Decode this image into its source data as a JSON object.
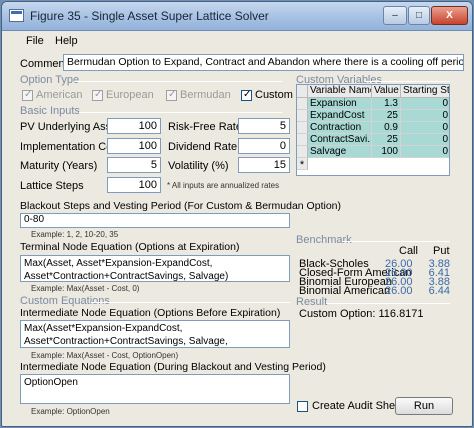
{
  "window": {
    "title": "Figure 35 - Single Asset Super Lattice Solver"
  },
  "titlebar_buttons": {
    "minimize": "–",
    "maximize": "□",
    "close": "X"
  },
  "menu": [
    "File",
    "Help"
  ],
  "comment": {
    "label": "Comment",
    "value": "Bermudan Option to Expand, Contract and Abandon where there is a cooling off period (blackout step periods)."
  },
  "option_type": {
    "label": "Option Type",
    "options": [
      {
        "label": "American",
        "checked": false
      },
      {
        "label": "European",
        "checked": false
      },
      {
        "label": "Bermudan",
        "checked": false
      },
      {
        "label": "Custom",
        "checked": true
      }
    ]
  },
  "basic_inputs": {
    "label": "Basic Inputs",
    "pv_asset": {
      "label": "PV Underlying Asset ($)",
      "value": "100"
    },
    "impl_cost": {
      "label": "Implementation Cost ($)",
      "value": "100"
    },
    "maturity": {
      "label": "Maturity (Years)",
      "value": "5"
    },
    "lattice_steps": {
      "label": "Lattice Steps",
      "value": "100"
    },
    "risk_free": {
      "label": "Risk-Free Rate (%)",
      "value": "5"
    },
    "dividend": {
      "label": "Dividend Rate (%)",
      "value": "0"
    },
    "volatility": {
      "label": "Volatility (%)",
      "value": "15"
    },
    "note": "* All inputs are annualized rates"
  },
  "blackout": {
    "label": "Blackout Steps and Vesting Period (For Custom & Bermudan Option)",
    "value": "0-80",
    "example": "Example: 1, 2, 10-20, 35"
  },
  "terminal": {
    "label": "Terminal Node Equation (Options at Expiration)",
    "value": "Max(Asset, Asset*Expansion-ExpandCost, Asset*Contraction+ContractSavings, Salvage)",
    "example": "Example: Max(Asset - Cost, 0)"
  },
  "custom_equations": {
    "label": "Custom Equations"
  },
  "intermediate": {
    "label": "Intermediate Node Equation (Options Before Expiration)",
    "value": "Max(Asset*Expansion-ExpandCost, Asset*Contraction+ContractSavings, Salvage, OptionOpen)",
    "example": "Example: Max(Asset - Cost, OptionOpen)"
  },
  "blackout_eq": {
    "label": "Intermediate Node Equation (During Blackout and Vesting Period)",
    "value": "OptionOpen",
    "example": "Example: OptionOpen"
  },
  "custom_variables": {
    "label": "Custom Variables",
    "columns": [
      "Variable Name",
      "Value",
      "Starting Step"
    ],
    "rows": [
      [
        "Expansion",
        "1.3",
        "0"
      ],
      [
        "ExpandCost",
        "25",
        "0"
      ],
      [
        "Contraction",
        "0.9",
        "0"
      ],
      [
        "ContractSavi...",
        "25",
        "0"
      ],
      [
        "Salvage",
        "100",
        "0"
      ]
    ],
    "new_row_marker": "*"
  },
  "benchmark": {
    "label": "Benchmark",
    "columns": [
      "Call",
      "Put"
    ],
    "rows": [
      {
        "name": "Black-Scholes",
        "call": "26.00",
        "put": "3.88"
      },
      {
        "name": "Closed-Form American",
        "call": "26.00",
        "put": "6.41"
      },
      {
        "name": "Binomial European",
        "call": "26.00",
        "put": "3.88"
      },
      {
        "name": "Binomial American",
        "call": "26.00",
        "put": "6.44"
      }
    ]
  },
  "result": {
    "label": "Result",
    "text": "Custom Option: 116.8171"
  },
  "audit": {
    "label": "Create Audit Sheet",
    "checked": false
  },
  "run_button": "Run",
  "colors": {
    "accent": "#3a6aa9",
    "group_label": "#7d8aa3",
    "grid_selection": "#a8d9d5"
  }
}
